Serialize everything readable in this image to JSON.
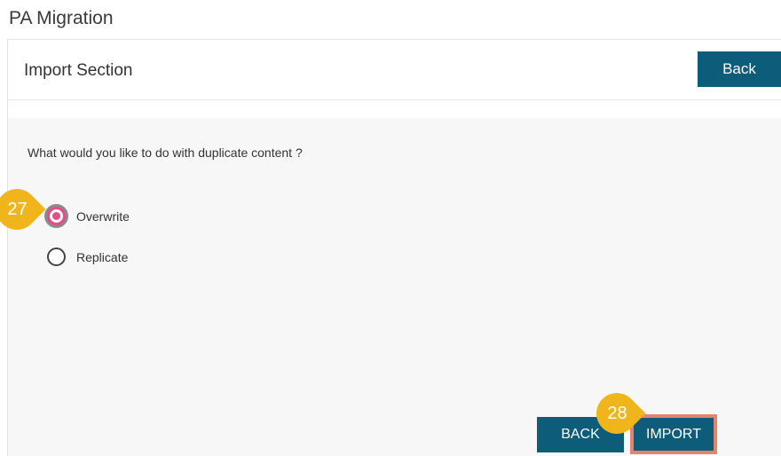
{
  "page": {
    "title": "PA Migration"
  },
  "header": {
    "section_title": "Import Section",
    "back_label": "Back"
  },
  "body": {
    "question": "What would you like to do with duplicate content ?",
    "options": [
      {
        "label": "Overwrite",
        "selected": true
      },
      {
        "label": "Replicate",
        "selected": false
      }
    ]
  },
  "footer": {
    "back_label": "BACK",
    "import_label": "IMPORT"
  },
  "callouts": {
    "step1": "27",
    "step2": "28"
  },
  "colors": {
    "primary": "#0d5c7a",
    "callout": "#f1b51c",
    "highlight": "#e8826a",
    "radio_selected": "#e84a8a"
  }
}
